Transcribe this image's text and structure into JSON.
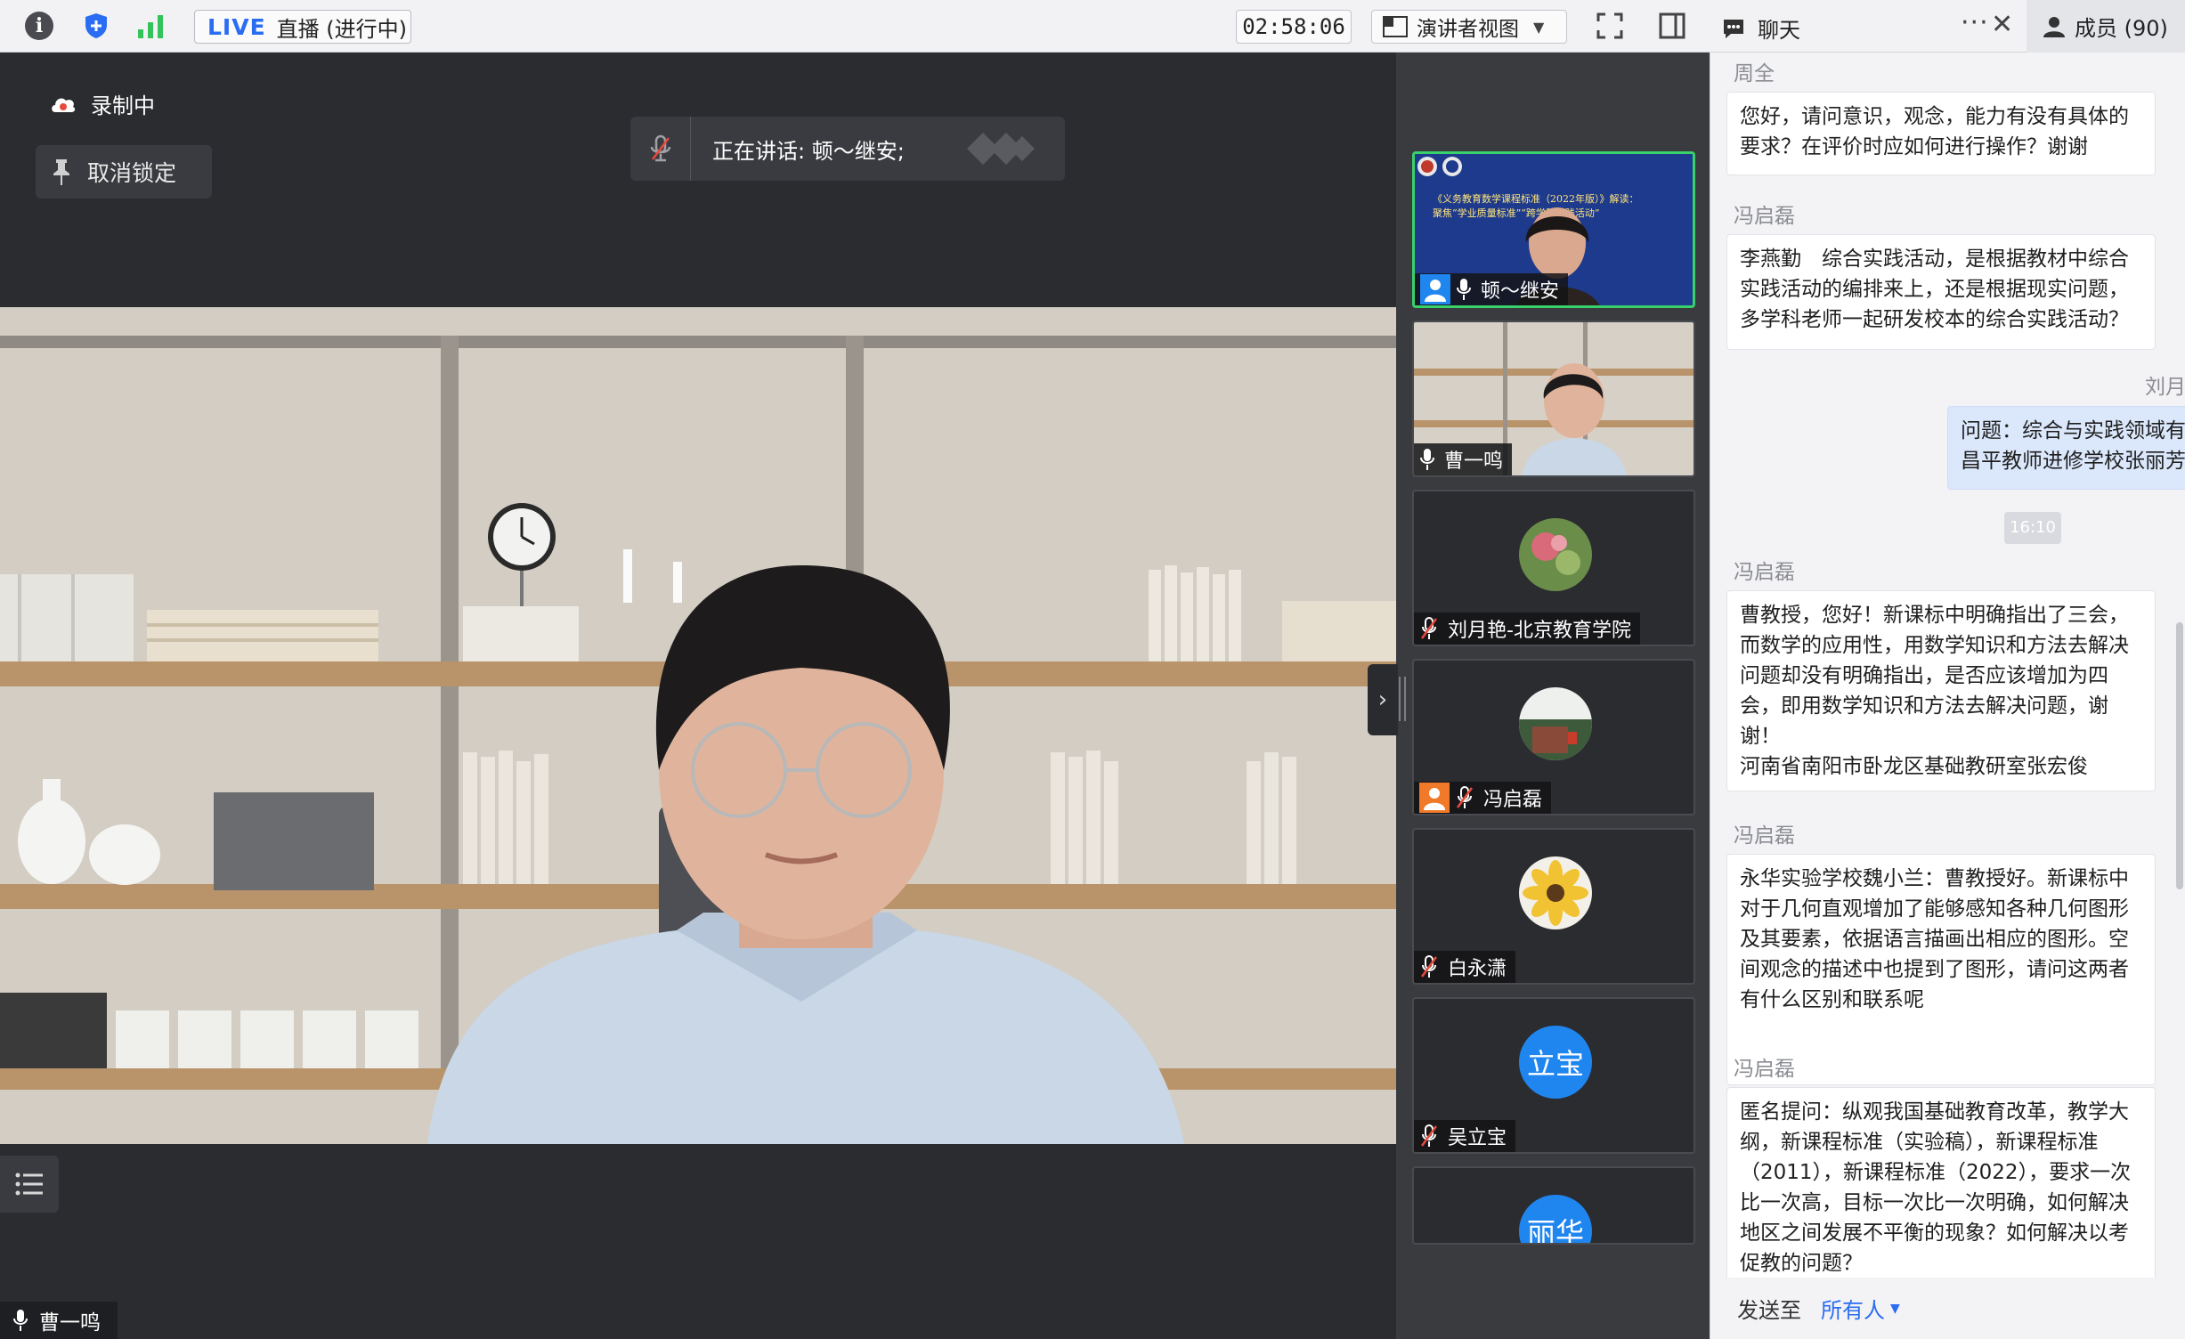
{
  "toolbar": {
    "live_tag": "LIVE",
    "live_status": "直播 (进行中)",
    "timer": "02:58:06",
    "view_mode": "演讲者视图"
  },
  "chat_header": {
    "chat_tab": "聊天",
    "members_tab": "成员 (90)"
  },
  "main": {
    "recording_label": "录制中",
    "unlock_label": "取消锁定",
    "speaking_label": "正在讲话: 顿～继安;",
    "speaker_name": "曹一鸣"
  },
  "participants": [
    {
      "name": "顿～继安",
      "muted": false,
      "has_user_icon": true,
      "user_icon_color": "#1f86f0",
      "active": true
    },
    {
      "name": "曹一鸣",
      "muted": false,
      "has_user_icon": false,
      "active": false
    },
    {
      "name": "刘月艳-北京教育学院",
      "muted": true,
      "has_user_icon": false,
      "active": false
    },
    {
      "name": "冯启磊",
      "muted": true,
      "has_user_icon": true,
      "user_icon_color": "#f07a2a",
      "active": false
    },
    {
      "name": "白永潇",
      "muted": true,
      "has_user_icon": false,
      "active": false
    },
    {
      "name": "吴立宝",
      "muted": true,
      "has_user_icon": false,
      "avatar_text": "立宝",
      "active": false
    },
    {
      "name": "",
      "muted": false,
      "has_user_icon": false,
      "avatar_text": "丽华",
      "active": false
    }
  ],
  "chat": {
    "messages": [
      {
        "sender": "周全",
        "text": "您好，请问意识，观念，能力有没有具体的要求？在评价时应如何进行操作？谢谢"
      },
      {
        "sender": "冯启磊",
        "text": "李燕勤　综合实践活动，是根据教材中综合实践活动的编排来上，还是根据现实问题，多学科老师一起研发校本的综合实践活动？"
      },
      {
        "sender": "刘月艳",
        "text": "问题：综合与实践领域有\n昌平教师进修学校张丽芳",
        "self": true
      },
      {
        "sender": "冯启磊",
        "text": "曹教授，您好！新课标中明确指出了三会，而数学的应用性，用数学知识和方法去解决问题却没有明确指出，是否应该增加为四会，即用数学知识和方法去解决问题，谢谢！\n河南省南阳市卧龙区基础教研室张宏俊"
      },
      {
        "sender": "冯启磊",
        "text": "永华实验学校魏小兰：曹教授好。新课标中对于几何直观增加了能够感知各种几何图形及其要素，依据语言描画出相应的图形。空间观念的描述中也提到了图形，请问这两者有什么区别和联系呢"
      },
      {
        "sender": "冯启磊",
        "text": "匿名提问：纵观我国基础教育改革，教学大纲，新课程标准（实验稿），新课程标准（2011），新课程标准（2022），要求一次比一次高，目标一次比一次明确，如何解决地区之间发展不平衡的现象？如何解决以考促教的问题？"
      }
    ],
    "time_divider": "16:10",
    "send_label": "发送至",
    "send_target": "所有人"
  },
  "video": {
    "slide_title_line1": "《义务教育数学课程标准（2022年版）》解读：",
    "slide_title_line2": "聚焦“学业质量标准”“跨学科实践活动”"
  },
  "colors": {
    "accent": "#2a6cf2",
    "active_border": "#38d16a",
    "muted_mic": "#e84a3b"
  }
}
